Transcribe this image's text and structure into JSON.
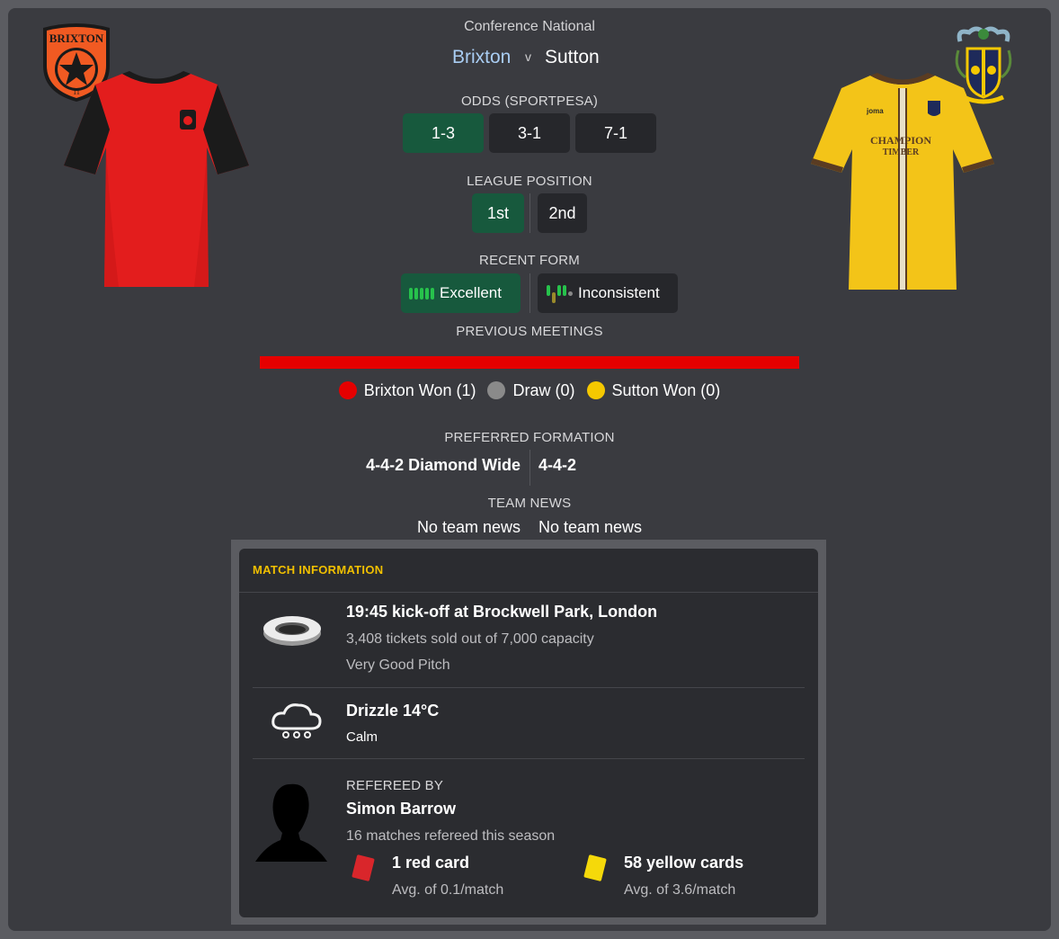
{
  "header": {
    "competition": "Conference National",
    "home_team": "Brixton",
    "versus": "v",
    "away_team": "Sutton"
  },
  "crests": {
    "home_text_top": "BRIXTON",
    "home_text_bottom": "11"
  },
  "kits": {
    "away_sponsor_line1": "CHAMPION",
    "away_sponsor_line2": "TIMBER",
    "away_maker": "joma"
  },
  "odds": {
    "label": "ODDS (SPORTPESA)",
    "home": "1-3",
    "draw": "3-1",
    "away": "7-1"
  },
  "league_position": {
    "label": "LEAGUE POSITION",
    "home": "1st",
    "away": "2nd"
  },
  "recent_form": {
    "label": "RECENT FORM",
    "home": "Excellent",
    "away": "Inconsistent"
  },
  "previous_meetings": {
    "label": "PREVIOUS MEETINGS",
    "home_won": 1,
    "draw": 0,
    "away_won": 0,
    "legend_home": "Brixton Won (1)",
    "legend_draw": "Draw (0)",
    "legend_away": "Sutton Won (0)",
    "colors": {
      "home": "#e50000",
      "draw": "#8a8a8a",
      "away": "#f5c800"
    }
  },
  "preferred_formation": {
    "label": "PREFERRED FORMATION",
    "home": "4-4-2 Diamond Wide",
    "away": "4-4-2"
  },
  "team_news": {
    "label": "TEAM NEWS",
    "home": "No team news",
    "away": "No team news"
  },
  "match_info": {
    "title": "MATCH INFORMATION",
    "stadium_icon": "stadium-icon",
    "kickoff": "19:45 kick-off at Brockwell Park, London",
    "tickets": "3,408 tickets sold out of 7,000 capacity",
    "pitch": "Very Good Pitch",
    "weather_icon": "drizzle-cloud-icon",
    "weather": "Drizzle 14°C",
    "wind": "Calm",
    "referee_label": "REFEREED BY",
    "referee_name": "Simon Barrow",
    "referee_matches": "16 matches refereed this season",
    "red_cards": "1 red card",
    "red_avg": "Avg. of 0.1/match",
    "yellow_cards": "58 yellow cards",
    "yellow_avg": "Avg. of 3.6/match"
  },
  "colors": {
    "accent_green": "#17593d",
    "title_yellow": "#f1c000",
    "home_name_blue": "#a9cdf3"
  }
}
